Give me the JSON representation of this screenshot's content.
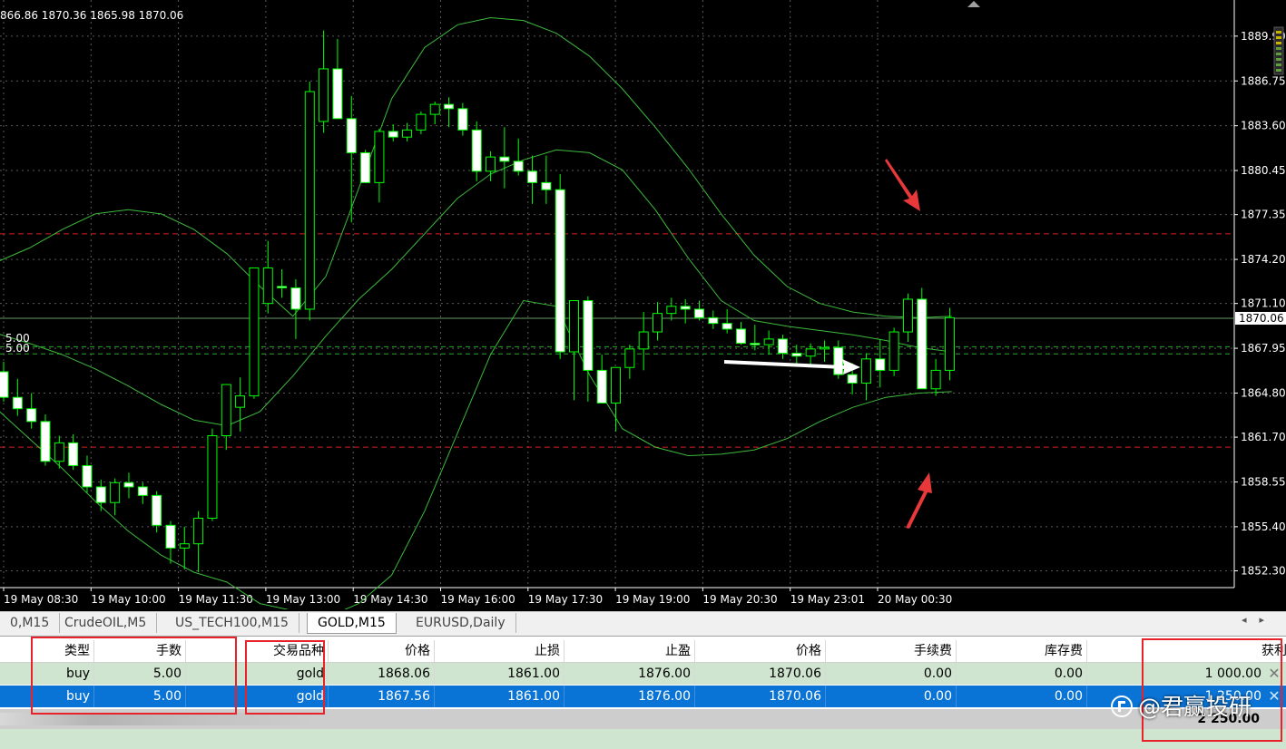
{
  "chart": {
    "ohlc_text": "866.86 1870.36 1865.98 1870.06",
    "lot_label": "5.00",
    "lot_label2": "5.00",
    "current_price": "1870.06",
    "price_ticks": [
      "1889.90",
      "1886.75",
      "1883.60",
      "1880.45",
      "1877.35",
      "1874.20",
      "1871.10",
      "1867.95",
      "1864.80",
      "1861.70",
      "1858.55",
      "1855.40",
      "1852.30"
    ],
    "time_ticks": [
      "19 May 08:30",
      "19 May 10:00",
      "19 May 11:30",
      "19 May 13:00",
      "19 May 14:30",
      "19 May 16:00",
      "19 May 17:30",
      "19 May 19:00",
      "19 May 20:30",
      "19 May 23:01",
      "20 May 00:30"
    ],
    "colors": {
      "bull": "#00ff00",
      "bear_body": "#ffffff",
      "bands": "#3cba3c",
      "stop_line": "#d42020",
      "entry_line": "#2aa82a",
      "price_line": "#6a9a6a",
      "grid": "#5a5a5a"
    }
  },
  "chart_data": {
    "type": "candlestick",
    "xlabel": "",
    "ylabel": "",
    "ylim": [
      1851.5,
      1891.0
    ],
    "levels": {
      "stop_loss": 1861.0,
      "take_profit": 1876.0,
      "entry_1": 1868.06,
      "entry_2": 1867.56,
      "current": 1870.06
    },
    "candles": [
      [
        1866.3,
        1867.0,
        1864.2,
        1864.5
      ],
      [
        1864.5,
        1865.8,
        1863.2,
        1863.7
      ],
      [
        1863.7,
        1864.8,
        1862.3,
        1862.8
      ],
      [
        1862.8,
        1863.3,
        1859.7,
        1860.0
      ],
      [
        1860.0,
        1861.8,
        1859.5,
        1861.3
      ],
      [
        1861.3,
        1861.9,
        1859.4,
        1859.7
      ],
      [
        1859.7,
        1860.4,
        1857.8,
        1858.2
      ],
      [
        1858.2,
        1858.7,
        1856.5,
        1857.1
      ],
      [
        1857.1,
        1858.8,
        1856.2,
        1858.5
      ],
      [
        1858.5,
        1859.2,
        1857.4,
        1858.2
      ],
      [
        1858.2,
        1858.5,
        1857.0,
        1857.6
      ],
      [
        1857.6,
        1857.9,
        1855.0,
        1855.5
      ],
      [
        1855.5,
        1855.8,
        1852.8,
        1853.9
      ],
      [
        1853.9,
        1855.4,
        1852.4,
        1854.2
      ],
      [
        1854.2,
        1856.5,
        1852.2,
        1856.0
      ],
      [
        1856.0,
        1862.3,
        1855.8,
        1861.8
      ],
      [
        1861.8,
        1862.3,
        1860.8,
        1865.4
      ],
      [
        1863.8,
        1865.9,
        1862.1,
        1864.6
      ],
      [
        1864.6,
        1867.5,
        1864.4,
        1873.6
      ],
      [
        1871.1,
        1875.5,
        1870.4,
        1873.6
      ],
      [
        1872.3,
        1873.5,
        1871.5,
        1872.2
      ],
      [
        1872.2,
        1872.8,
        1868.6,
        1870.7
      ],
      [
        1870.7,
        1886.7,
        1869.9,
        1886.0
      ],
      [
        1883.9,
        1890.3,
        1883.1,
        1887.6
      ],
      [
        1887.6,
        1889.7,
        1885.3,
        1884.1
      ],
      [
        1884.1,
        1885.7,
        1876.8,
        1881.7
      ],
      [
        1881.7,
        1881.9,
        1879.8,
        1879.6
      ],
      [
        1879.6,
        1883.4,
        1878.2,
        1883.2
      ],
      [
        1883.2,
        1883.7,
        1882.5,
        1882.8
      ],
      [
        1882.8,
        1883.8,
        1882.5,
        1883.3
      ],
      [
        1883.3,
        1884.6,
        1883.0,
        1884.4
      ],
      [
        1884.4,
        1885.3,
        1883.7,
        1885.1
      ],
      [
        1885.1,
        1885.6,
        1883.5,
        1884.8
      ],
      [
        1884.8,
        1885.2,
        1882.9,
        1883.3
      ],
      [
        1883.3,
        1883.9,
        1879.7,
        1880.4
      ],
      [
        1880.4,
        1881.8,
        1879.7,
        1881.4
      ],
      [
        1881.4,
        1883.5,
        1879.2,
        1881.1
      ],
      [
        1881.1,
        1882.7,
        1880.1,
        1880.4
      ],
      [
        1880.4,
        1881.5,
        1878.1,
        1879.6
      ],
      [
        1879.6,
        1881.5,
        1878.1,
        1879.1
      ],
      [
        1879.1,
        1880.2,
        1867.2,
        1867.7
      ],
      [
        1867.7,
        1869.7,
        1864.3,
        1871.3
      ],
      [
        1871.3,
        1871.6,
        1864.2,
        1866.4
      ],
      [
        1866.4,
        1867.5,
        1865.9,
        1864.1
      ],
      [
        1864.1,
        1866.6,
        1862.1,
        1866.6
      ],
      [
        1866.6,
        1868.2,
        1865.8,
        1867.9
      ],
      [
        1867.9,
        1870.5,
        1866.4,
        1869.1
      ],
      [
        1869.1,
        1871.2,
        1868.5,
        1870.4
      ],
      [
        1870.4,
        1871.5,
        1869.9,
        1870.9
      ],
      [
        1870.9,
        1871.4,
        1869.7,
        1870.7
      ],
      [
        1870.7,
        1871.3,
        1869.9,
        1870.1
      ],
      [
        1870.1,
        1870.6,
        1869.3,
        1869.7
      ],
      [
        1869.7,
        1870.7,
        1869.0,
        1869.3
      ],
      [
        1869.3,
        1869.8,
        1868.2,
        1868.3
      ],
      [
        1868.3,
        1869.6,
        1867.8,
        1868.2
      ],
      [
        1868.2,
        1869.2,
        1867.5,
        1868.6
      ],
      [
        1868.6,
        1868.9,
        1867.2,
        1867.6
      ],
      [
        1867.6,
        1868.2,
        1866.8,
        1867.4
      ],
      [
        1867.4,
        1868.3,
        1866.6,
        1867.9
      ],
      [
        1867.9,
        1868.5,
        1867.0,
        1868.0
      ],
      [
        1868.0,
        1868.5,
        1865.8,
        1866.1
      ],
      [
        1866.1,
        1866.9,
        1864.7,
        1865.5
      ],
      [
        1865.5,
        1867.6,
        1864.3,
        1867.2
      ],
      [
        1867.2,
        1868.6,
        1865.2,
        1866.4
      ],
      [
        1866.4,
        1869.4,
        1866.0,
        1869.1
      ],
      [
        1869.1,
        1871.8,
        1868.4,
        1871.4
      ],
      [
        1871.4,
        1872.2,
        1865.8,
        1865.1
      ],
      [
        1865.1,
        1867.2,
        1864.6,
        1866.4
      ],
      [
        1866.4,
        1870.8,
        1865.7,
        1870.1
      ]
    ],
    "bands": {
      "upper": [
        1874,
        1875,
        1876.3,
        1877.4,
        1877.7,
        1877.4,
        1876.3,
        1874.6,
        1872.3,
        1870.2,
        1873.0,
        1879.2,
        1885.5,
        1889.1,
        1890.7,
        1891.2,
        1891.0,
        1890.1,
        1888.5,
        1886.2,
        1883.5,
        1880.6,
        1877.4,
        1874.5,
        1872.3,
        1871.1,
        1870.5,
        1870.2,
        1870.1,
        1870.2
      ],
      "middle": [
        1869.0,
        1868.3,
        1867.5,
        1866.5,
        1865.3,
        1864.0,
        1862.9,
        1862.5,
        1863.5,
        1866.0,
        1868.8,
        1871.4,
        1873.5,
        1876.0,
        1878.5,
        1880.2,
        1881.2,
        1881.9,
        1881.7,
        1880.5,
        1877.7,
        1874.3,
        1871.3,
        1869.9,
        1869.5,
        1869.2,
        1868.9,
        1868.5,
        1868.0,
        1867.7
      ],
      "lower": [
        1863.7,
        1861.6,
        1859.5,
        1857.2,
        1855.1,
        1853.4,
        1852.2,
        1851.5,
        1850,
        1849.5,
        1849.0,
        1850.0,
        1852.0,
        1856.5,
        1862.0,
        1867.5,
        1871.3,
        1870.9,
        1866.1,
        1862.3,
        1861.0,
        1860.4,
        1860.5,
        1860.8,
        1861.6,
        1862.8,
        1863.8,
        1864.5,
        1864.8,
        1864.9
      ]
    }
  },
  "tabs": [
    {
      "label": "0,M15",
      "active": false
    },
    {
      "label": "CrudeOIL,M5",
      "active": false
    },
    {
      "label": "US_TECH100,M15",
      "active": false
    },
    {
      "label": "GOLD,M15",
      "active": true
    },
    {
      "label": "EURUSD,Daily",
      "active": false
    }
  ],
  "tab_scroll": {
    "left": "◂",
    "right": "▸"
  },
  "table": {
    "headers": [
      "类型",
      "手数",
      "交易品种",
      "价格",
      "止损",
      "止盈",
      "价格",
      "手续费",
      "库存费",
      "获利"
    ],
    "rows": [
      [
        "buy",
        "5.00",
        "gold",
        "1868.06",
        "1861.00",
        "1876.00",
        "1870.06",
        "0.00",
        "0.00",
        "1 000.00"
      ],
      [
        "buy",
        "5.00",
        "gold",
        "1867.56",
        "1861.00",
        "1876.00",
        "1870.06",
        "0.00",
        "0.00",
        "1 250.00"
      ]
    ],
    "close_glyph": "✕",
    "total": "2 250.00"
  },
  "watermark": {
    "text": "@君赢投研"
  }
}
